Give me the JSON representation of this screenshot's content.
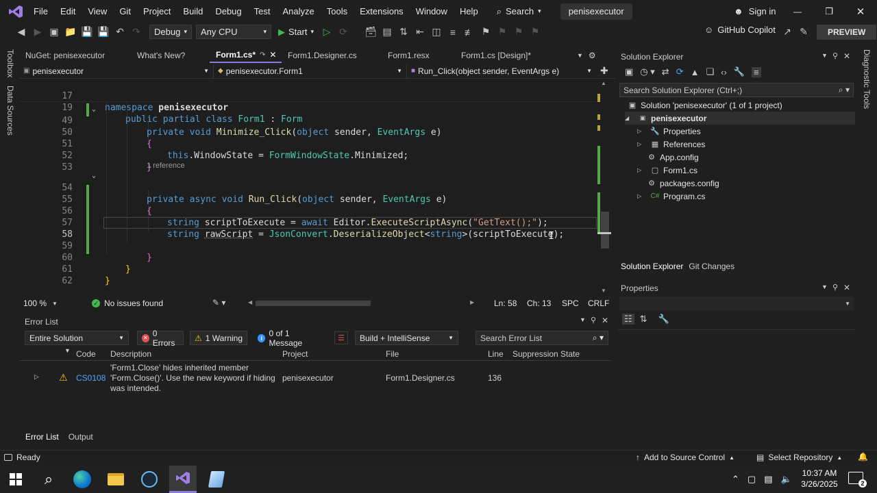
{
  "menubar": {
    "items": [
      "File",
      "Edit",
      "View",
      "Git",
      "Project",
      "Build",
      "Debug",
      "Test",
      "Analyze",
      "Tools",
      "Extensions",
      "Window",
      "Help"
    ],
    "search_label": "Search",
    "project_name": "penisexecutor",
    "sign_in": "Sign in"
  },
  "toolbar": {
    "config": "Debug",
    "platform": "Any CPU",
    "start_label": "Start",
    "copilot": "GitHub Copilot",
    "preview": "PREVIEW"
  },
  "left_strip": {
    "toolbox": "Toolbox",
    "data_sources": "Data Sources"
  },
  "right_strip": {
    "diagnostic": "Diagnostic Tools"
  },
  "doc_tabs": [
    {
      "label": "NuGet: penisexecutor"
    },
    {
      "label": "What's New?"
    },
    {
      "label": "Form1.cs*"
    },
    {
      "label": "Form1.Designer.cs"
    },
    {
      "label": "Form1.resx"
    },
    {
      "label": "Form1.cs [Design]*"
    }
  ],
  "navbar": {
    "project": "penisexecutor",
    "class": "penisexecutor.Form1",
    "member": "Run_Click(object sender, EventArgs e)"
  },
  "editor": {
    "sticky": [
      {
        "num": "17",
        "text": "namespace penisexecutor"
      },
      {
        "num": "19",
        "text": "public partial class Form1 : Form"
      }
    ],
    "lines": [
      {
        "num": "49",
        "text": "private void Minimize_Click(object sender, EventArgs e)"
      },
      {
        "num": "50",
        "text": "{"
      },
      {
        "num": "51",
        "text": "this.WindowState = FormWindowState.Minimized;"
      },
      {
        "num": "52",
        "text": "}"
      },
      {
        "num": "53",
        "text": ""
      },
      {
        "num": "54",
        "text": "private async void Run_Click(object sender, EventArgs e)"
      },
      {
        "num": "55",
        "text": "{"
      },
      {
        "num": "56",
        "text": "string scriptToExecute = await Editor.ExecuteScriptAsync(\"GetText();\");"
      },
      {
        "num": "57",
        "text": "string rawScript = JsonConvert.DeserializeObject<string>(scriptToExecute);"
      },
      {
        "num": "58",
        "text": ""
      },
      {
        "num": "59",
        "text": "}"
      },
      {
        "num": "60",
        "text": "}"
      },
      {
        "num": "61",
        "text": "}"
      },
      {
        "num": "62",
        "text": ""
      }
    ],
    "codelens": "1 reference",
    "tokens": {
      "namespace": "namespace",
      "penisexecutor": "penisexecutor",
      "public": "public",
      "partial": "partial",
      "class": "class",
      "Form1": "Form1",
      "colon": ":",
      "Form": "Form",
      "private": "private",
      "void": "void",
      "Minimize_Click": "Minimize_Click",
      "paren_open": "(",
      "object": "object",
      "sender": "sender",
      "comma": ",",
      "EventArgs": "EventArgs",
      "e": "e",
      "paren_close": ")",
      "brace_open": "{",
      "brace_close": "}",
      "this": "this",
      "dot": ".",
      "WindowState": "WindowState",
      "eq": "=",
      "FormWindowState": "FormWindowState",
      "Minimized": "Minimized",
      "semi": ";",
      "async": "async",
      "Run_Click": "Run_Click",
      "string": "string",
      "scriptToExecute": "scriptToExecute",
      "await": "await",
      "Editor": "Editor",
      "ExecuteScriptAsync": "ExecuteScriptAsync",
      "literal": "\"GetText();\"",
      "rawScript": "rawScript",
      "JsonConvert": "JsonConvert",
      "DeserializeObject": "DeserializeObject",
      "lt": "<",
      "gt": ">"
    }
  },
  "editor_status": {
    "zoom": "100 %",
    "issues": "No issues found",
    "line": "Ln: 58",
    "col": "Ch: 13",
    "spc": "SPC",
    "crlf": "CRLF"
  },
  "error_list": {
    "title": "Error List",
    "scope": "Entire Solution",
    "errors": "0 Errors",
    "warnings": "1 Warning",
    "messages": "0 of 1 Message",
    "build_filter": "Build + IntelliSense",
    "search_placeholder": "Search Error List",
    "headers": {
      "code": "Code",
      "description": "Description",
      "project": "Project",
      "file": "File",
      "line": "Line",
      "suppression": "Suppression State"
    },
    "rows": [
      {
        "code": "CS0108",
        "description_1": "'Form1.Close' hides inherited member",
        "description_2": "'Form.Close()'. Use the new keyword if hiding",
        "description_3": "was intended.",
        "project": "penisexecutor",
        "file": "Form1.Designer.cs",
        "line": "136"
      }
    ],
    "bottom_tabs": [
      "Error List",
      "Output"
    ]
  },
  "solution_explorer": {
    "title": "Solution Explorer",
    "search_placeholder": "Search Solution Explorer (Ctrl+;)",
    "solution": "Solution 'penisexecutor' (1 of 1 project)",
    "project": "penisexecutor",
    "items": [
      "Properties",
      "References",
      "App.config",
      "Form1.cs",
      "packages.config",
      "Program.cs"
    ],
    "tabs": [
      "Solution Explorer",
      "Git Changes"
    ]
  },
  "properties": {
    "title": "Properties"
  },
  "statusbar": {
    "ready": "Ready",
    "source_control": "Add to Source Control",
    "repository": "Select Repository"
  },
  "taskbar": {
    "time": "10:37 AM",
    "date": "3/26/2025",
    "notification_count": "2"
  },
  "colors": {
    "accent": "#8e7bd9",
    "keyword": "#569cd6",
    "type": "#4ec9b0",
    "method": "#dcdcaa",
    "string": "#d69d85",
    "change_bar": "#57a64a",
    "warning": "#f2c811",
    "error": "#e05252"
  }
}
